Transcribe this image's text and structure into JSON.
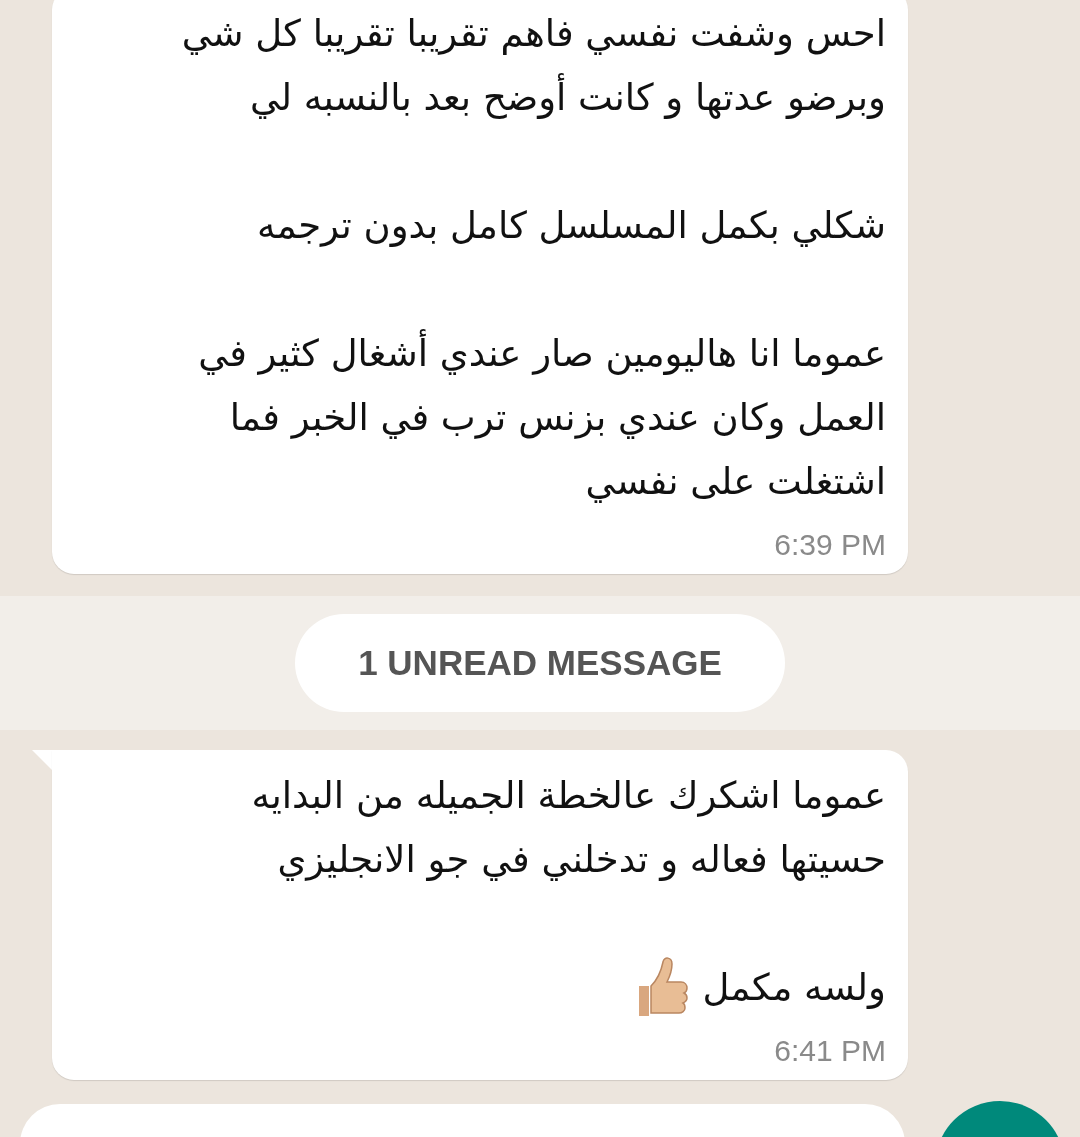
{
  "messages_before": [
    {
      "paragraphs": [
        [
          "احس وشفت نفسي فاهم تقريبا تقريبا كل شي",
          "وبرضو عدتها و كانت أوضح بعد بالنسبه لي"
        ],
        [
          "شكلي بكمل المسلسل كامل بدون ترجمه"
        ],
        [
          "عموما انا هاليومين صار عندي أشغال كثير في",
          "العمل وكان عندي بزنس ترب في الخبر فما",
          "اشتغلت على نفسي"
        ]
      ],
      "time": "6:39 PM"
    }
  ],
  "unread_banner": "1 UNREAD MESSAGE",
  "messages_after": [
    {
      "paragraphs": [
        [
          "عموما اشكرك عالخطة الجميله من البدايه",
          "حسيتها فعاله و تدخلني في جو الانجليزي"
        ],
        [
          "ولسه مكمل"
        ]
      ],
      "time": "6:41 PM",
      "tail": true,
      "thumbs_up": true
    }
  ]
}
